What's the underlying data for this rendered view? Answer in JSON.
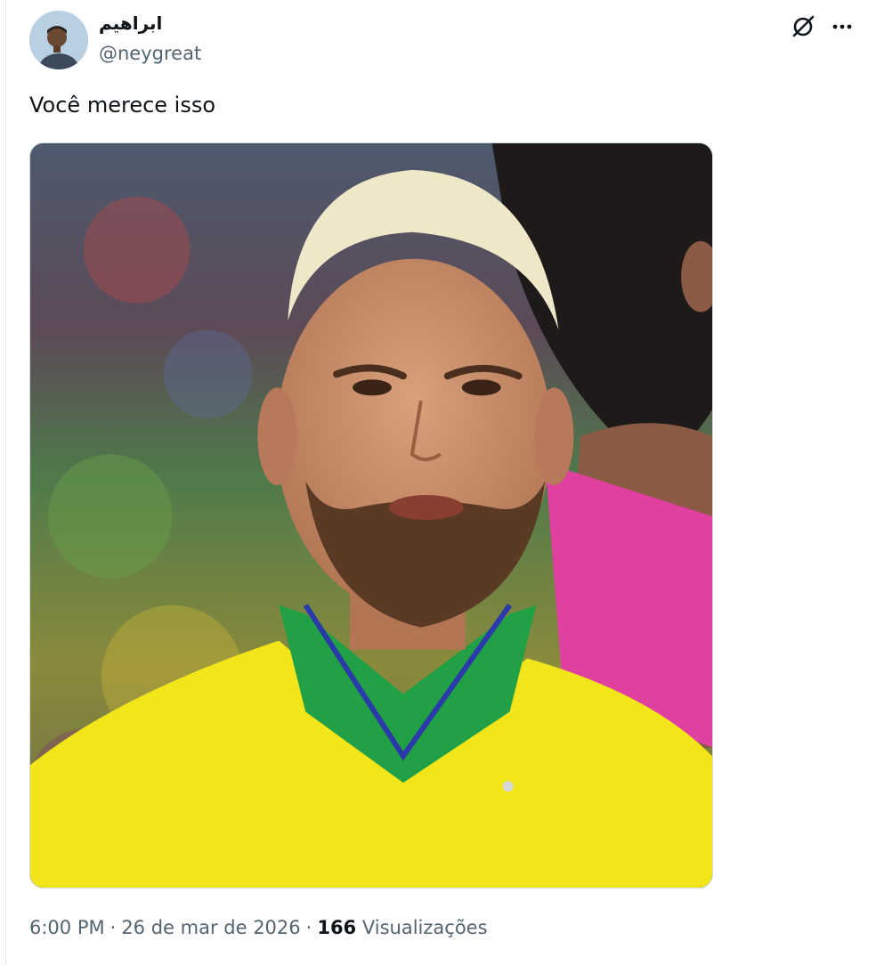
{
  "post": {
    "author": {
      "display_name": "ابراهيم",
      "handle": "@neygreat",
      "avatar_icon": "profile-avatar"
    },
    "text": "Você merece isso",
    "header_icons": [
      "grok-icon",
      "more-options-icon"
    ],
    "media": {
      "kind": "photo",
      "icon": "photo-player-portrait"
    },
    "meta": {
      "time": "6:00 PM",
      "separator": "·",
      "date": "26 de mar de 2026",
      "views_count": "166",
      "views_label": "Visualizações"
    }
  },
  "colors": {
    "text_primary": "#0f1419",
    "text_secondary": "#536471",
    "border": "#cfd9de"
  }
}
